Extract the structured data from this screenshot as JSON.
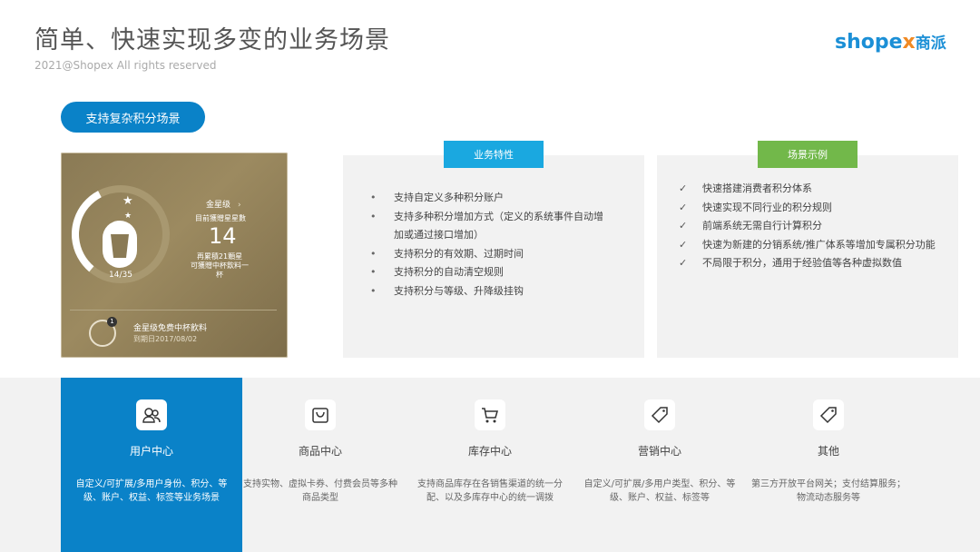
{
  "header": {
    "title": "简单、快速实现多变的业务场景",
    "copyright": "2021@Shopex All rights reserved",
    "logo_en": "shope",
    "logo_x": "x",
    "logo_cn": "商派"
  },
  "pill_label": "支持复杂积分场景",
  "card": {
    "level": "金星级",
    "level_arrow": "›",
    "current_label": "目前獲贈星星數",
    "stars": "14",
    "need_line1": "再累積21顆星",
    "need_line2": "可獲贈中杯飲料一杯",
    "progress": "14/35",
    "progress_fraction": 0.4,
    "coupon_badge": "1",
    "coupon_title": "金星级免费中杯飲料",
    "coupon_expiry": "到期日2017/08/02"
  },
  "features": {
    "heading": "业务特性",
    "items": [
      "支持自定义多种积分账户",
      "支持多种积分增加方式（定义的系统事件自动增加或通过接口增加）",
      "支持积分的有效期、过期时间",
      "支持积分的自动清空规则",
      "支持积分与等级、升降级挂钩"
    ]
  },
  "scenarios": {
    "heading": "场景示例",
    "items": [
      "快速搭建消费者积分体系",
      "快速实现不同行业的积分规则",
      "前端系统无需自行计算积分",
      "快速为新建的分销系统/推广体系等增加专属积分功能",
      "不局限于积分，通用于经验值等各种虚拟数值"
    ]
  },
  "modules": [
    {
      "name": "用户中心",
      "icon": "users-icon",
      "desc": "自定义/可扩展/多用户身份、积分、等级、账户、权益、标签等业务场景"
    },
    {
      "name": "商品中心",
      "icon": "bag-icon",
      "desc": "支持实物、虚拟卡券、付费会员等多种商品类型"
    },
    {
      "name": "库存中心",
      "icon": "cart-icon",
      "desc": "支持商品库存在各销售渠道的统一分配、以及多库存中心的统一调拨"
    },
    {
      "name": "营销中心",
      "icon": "tag-icon",
      "desc": "自定义/可扩展/多用户类型、积分、等级、账户、权益、标签等"
    },
    {
      "name": "其他",
      "icon": "tag-icon",
      "desc": "第三方开放平台网关；支付结算服务；物流动态服务等"
    }
  ],
  "colors": {
    "accent": "#0a82c8",
    "feature_head": "#1aa8e0",
    "scenario_head": "#72b84a",
    "card_gold": "#8a7a55"
  }
}
